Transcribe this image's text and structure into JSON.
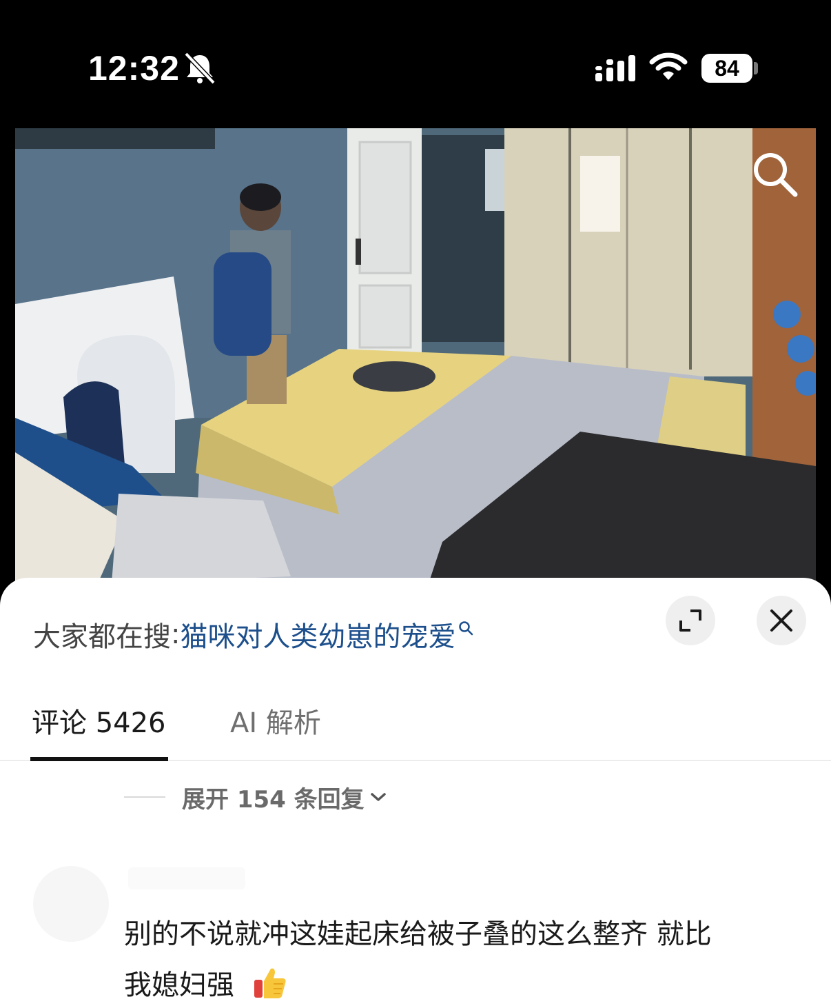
{
  "status_bar": {
    "time": "12:32",
    "battery": "84",
    "icons": [
      "bell-slash-icon",
      "signal-icon",
      "wifi-icon",
      "battery-icon"
    ]
  },
  "video": {
    "icons": [
      "search-icon"
    ]
  },
  "search_suggestion": {
    "prefix": "大家都在搜",
    "colon": ":",
    "query": "猫咪对人类幼崽的宠爱",
    "link_color": "#1c4f8c"
  },
  "sheet_controls": {
    "icons": [
      "expand-icon",
      "close-icon"
    ]
  },
  "tabs": [
    {
      "label": "评论 5426",
      "active": true
    },
    {
      "label": "AI 解析",
      "active": false
    }
  ],
  "replies": {
    "expand_label": "展开 154 条回复"
  },
  "comment": {
    "text_line1": "别的不说就冲这娃起床给被子叠的这么整齐 就比",
    "text_line2": "我媳妇强",
    "emoji": "thumbs-up-icon"
  }
}
